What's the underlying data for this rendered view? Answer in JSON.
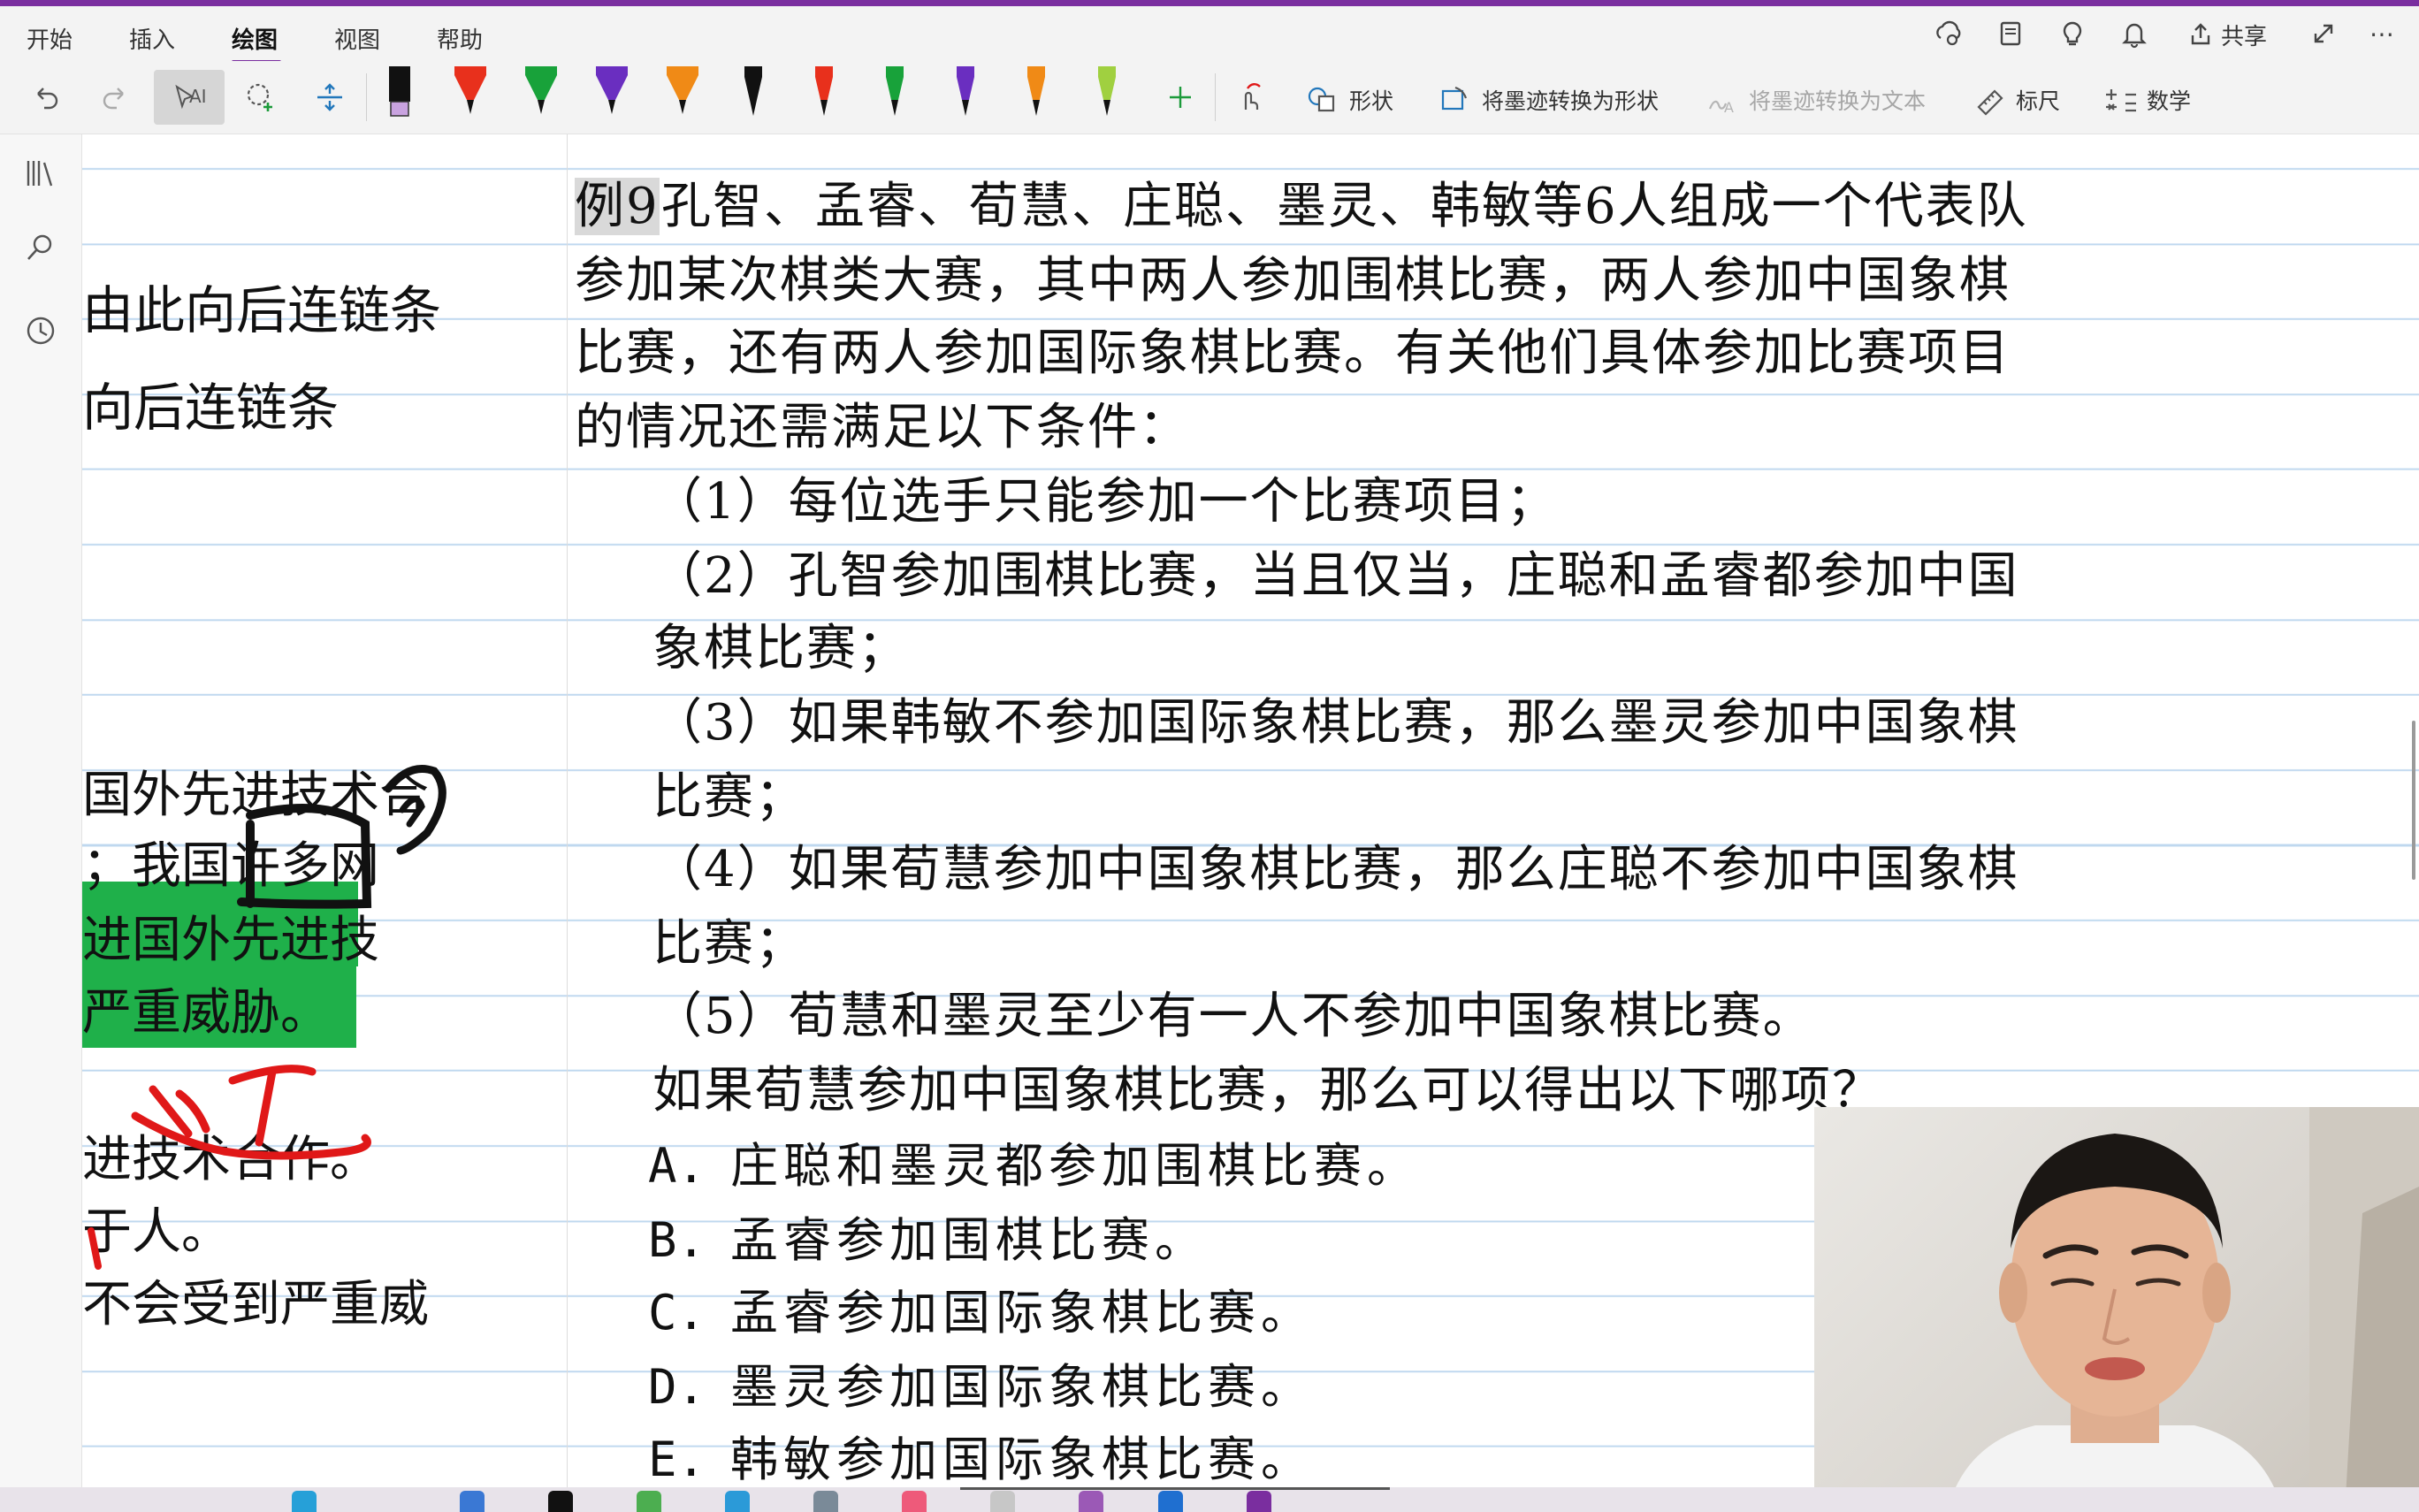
{
  "menu": {
    "tabs": [
      {
        "label": "开始"
      },
      {
        "label": "插入"
      },
      {
        "label": "绘图"
      },
      {
        "label": "视图"
      },
      {
        "label": "帮助"
      }
    ],
    "share_label": "共享"
  },
  "toolbar": {
    "shapes_label": "形状",
    "ink_to_shape_label": "将墨迹转换为形状",
    "ink_to_text_label": "将墨迹转换为文本",
    "ruler_label": "标尺",
    "math_label": "数学",
    "pen_colors": [
      "#111111",
      "#e8301c",
      "#18a23a",
      "#6a2ec0",
      "#f08a16",
      "#111111",
      "#e8301c",
      "#18a23a",
      "#6a2ec0",
      "#f08a16",
      "#a0d040"
    ]
  },
  "left_page": {
    "line1": "由此向后连链条",
    "line2": "向后连链条",
    "line3": "国外先进技术合",
    "line4": "；我国许多网",
    "line5": "进国外先进技",
    "line6": "严重威胁。",
    "line7": "进技术合作。",
    "line8": "于人。",
    "line9": "不会受到严重威"
  },
  "question": {
    "prefix": "例9",
    "l1": "孔智、孟睿、荀慧、庄聪、墨灵、韩敏等6人组成一个代表队",
    "l2": "参加某次棋类大赛，其中两人参加围棋比赛，两人参加中国象棋",
    "l3": "比赛，还有两人参加国际象棋比赛。有关他们具体参加比赛项目",
    "l4": "的情况还需满足以下条件：",
    "c1": "（1）每位选手只能参加一个比赛项目；",
    "c2a": "（2）孔智参加围棋比赛，当且仅当，庄聪和孟睿都参加中国",
    "c2b": "象棋比赛；",
    "c3a": "（3）如果韩敏不参加国际象棋比赛，那么墨灵参加中国象棋",
    "c3b": "比赛；",
    "c4a": "（4）如果荀慧参加中国象棋比赛，那么庄聪不参加中国象棋",
    "c4b": "比赛；",
    "c5": "（5）荀慧和墨灵至少有一人不参加中国象棋比赛。",
    "ask": "如果荀慧参加中国象棋比赛，那么可以得出以下哪项？",
    "options": [
      {
        "letter": "A.",
        "text": "庄聪和墨灵都参加围棋比赛。"
      },
      {
        "letter": "B.",
        "text": "孟睿参加围棋比赛。"
      },
      {
        "letter": "C.",
        "text": "孟睿参加国际象棋比赛。"
      },
      {
        "letter": "D.",
        "text": "墨灵参加国际象棋比赛。"
      },
      {
        "letter": "E.",
        "text": "韩敏参加国际象棋比赛。"
      }
    ]
  },
  "colors": {
    "accent": "#7a2e9f",
    "highlight_green": "#1fb04a",
    "ink_red": "#e01818"
  }
}
